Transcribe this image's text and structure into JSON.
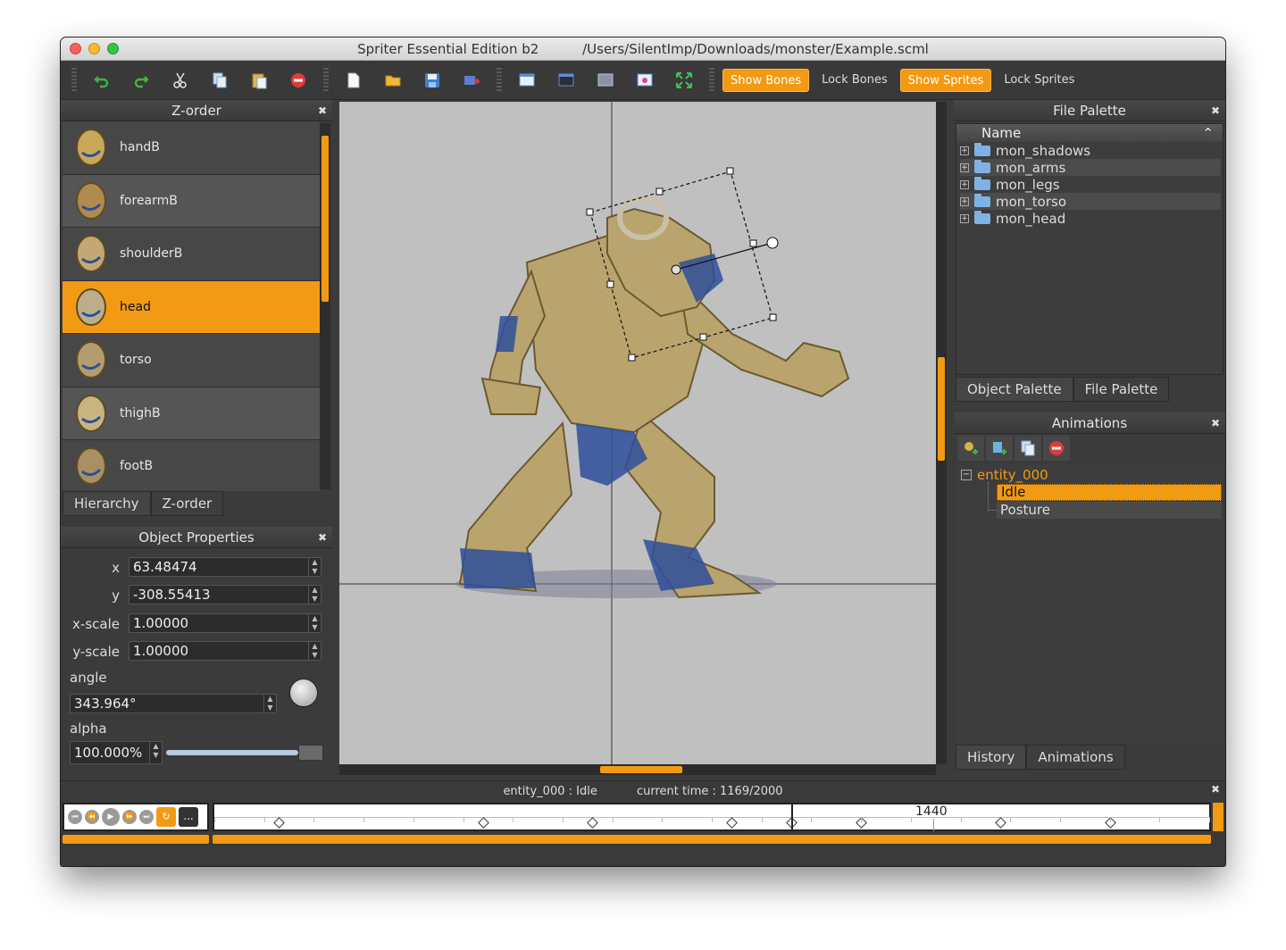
{
  "window": {
    "title": "Spriter Essential Edition b2",
    "path": "/Users/SilentImp/Downloads/monster/Example.scml"
  },
  "toolbar": {
    "icons": [
      "undo-icon",
      "redo-icon",
      "cut-icon",
      "copy-icon",
      "paste-icon",
      "delete-icon",
      "new-file-icon",
      "open-folder-icon",
      "save-icon",
      "import-icon",
      "window-1-icon",
      "window-2-icon",
      "window-3-icon",
      "window-4-icon",
      "fit-view-icon"
    ],
    "show_bones": "Show Bones",
    "lock_bones": "Lock Bones",
    "show_sprites": "Show Sprites",
    "lock_sprites": "Lock Sprites"
  },
  "zorder": {
    "title": "Z-order",
    "items": [
      "handB",
      "forearmB",
      "shoulderB",
      "head",
      "torso",
      "thighB",
      "footB"
    ],
    "selected": "head",
    "tabs": [
      "Hierarchy",
      "Z-order"
    ]
  },
  "object_properties": {
    "title": "Object Properties",
    "x_label": "x",
    "x": "63.48474",
    "y_label": "y",
    "y": "-308.55413",
    "xscale_label": "x-scale",
    "xscale": "1.00000",
    "yscale_label": "y-scale",
    "yscale": "1.00000",
    "angle_label": "angle",
    "angle": "343.964°",
    "alpha_label": "alpha",
    "alpha": "100.000%",
    "alpha_level": 1.0
  },
  "file_palette": {
    "title": "File Palette",
    "column": "Name",
    "folders": [
      "mon_shadows",
      "mon_arms",
      "mon_legs",
      "mon_torso",
      "mon_head"
    ],
    "tabs": [
      "Object Palette",
      "File Palette"
    ]
  },
  "animations": {
    "title": "Animations",
    "entity": "entity_000",
    "items": [
      "Idle",
      "Posture"
    ],
    "selected": "Idle",
    "tabs": [
      "History",
      "Animations"
    ]
  },
  "timeline": {
    "status": "entity_000 : Idle",
    "current_time": "current time : 1169/2000",
    "marker_label": "1440",
    "more_label": "...",
    "key_positions": [
      0.065,
      0.27,
      0.38,
      0.52,
      0.58,
      0.65,
      0.79,
      0.9
    ],
    "playhead": 0.58
  },
  "colors": {
    "accent": "#f39a14",
    "panel": "#3b3b3b",
    "canvas": "#c0c0c0"
  }
}
